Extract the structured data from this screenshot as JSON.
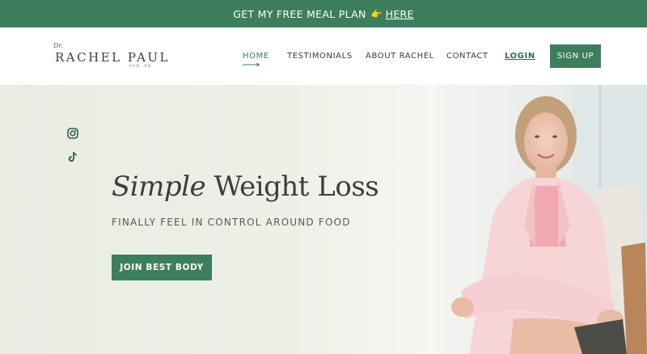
{
  "banner": {
    "text": "GET MY FREE MEAL PLAN",
    "emoji": "👉",
    "link_label": "HERE",
    "bg_color": "#3d7f5d"
  },
  "header": {
    "logo": {
      "prefix": "Dr.",
      "name": "RACHEL PAUL",
      "credentials": "PHD, RD"
    },
    "nav": {
      "home": "HOME",
      "testimonials": "TESTIMONIALS",
      "about": "ABOUT RACHEL",
      "contact": "CONTACT",
      "login": "LOGIN"
    },
    "signup_label": "SIGN UP"
  },
  "hero": {
    "social": [
      "instagram-icon",
      "tiktok-icon"
    ],
    "headline_italic": "Simple",
    "headline_rest": " Weight Loss",
    "subline": "FINALLY FEEL IN CONTROL AROUND FOOD",
    "cta_label": "JOIN BEST BODY",
    "accent_color": "#3d7f5d"
  }
}
